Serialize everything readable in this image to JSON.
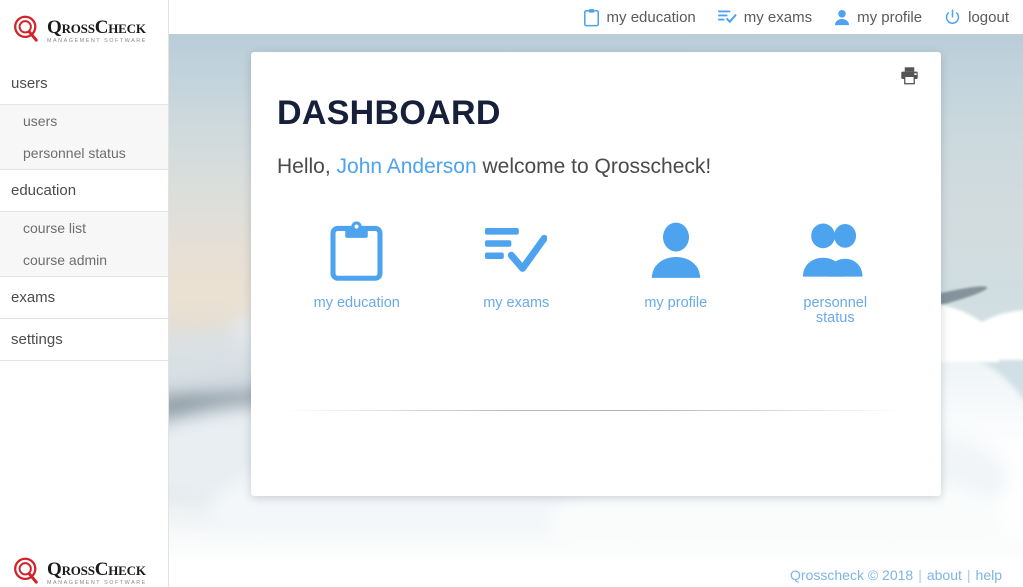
{
  "brand": {
    "name": "QrossCheck",
    "tagline": "MANAGEMENT SOFTWARE",
    "logo_color": "#d2232a"
  },
  "topnav": {
    "items": [
      {
        "label": "my education",
        "icon": "clipboard-icon"
      },
      {
        "label": "my exams",
        "icon": "list-check-icon"
      },
      {
        "label": "my profile",
        "icon": "person-icon"
      },
      {
        "label": "logout",
        "icon": "power-icon"
      }
    ]
  },
  "sidebar": {
    "groups": [
      {
        "label": "users",
        "items": [
          {
            "label": "users"
          },
          {
            "label": "personnel status"
          }
        ]
      },
      {
        "label": "education",
        "items": [
          {
            "label": "course list"
          },
          {
            "label": "course admin"
          }
        ]
      }
    ],
    "plain_items": [
      {
        "label": "exams"
      },
      {
        "label": "settings"
      }
    ]
  },
  "card": {
    "print_label": "print",
    "title": "DASHBOARD",
    "greeting_prefix": "Hello, ",
    "user_name": "John Anderson",
    "greeting_suffix": " welcome to Qrosscheck!",
    "shortcuts": [
      {
        "label": "my education",
        "icon": "clipboard-icon"
      },
      {
        "label": "my exams",
        "icon": "list-check-icon"
      },
      {
        "label": "my profile",
        "icon": "person-icon"
      },
      {
        "label": "personnel status",
        "icon": "people-icon"
      }
    ]
  },
  "footer": {
    "copyright": "Qrosscheck © 2018",
    "sep1": "|",
    "about": "about",
    "sep2": "|",
    "help": "help"
  },
  "colors": {
    "accent_blue": "#4da3ee",
    "brand_red": "#d2232a",
    "title_navy": "#17203a",
    "footer_blue": "#7fb4e4"
  }
}
